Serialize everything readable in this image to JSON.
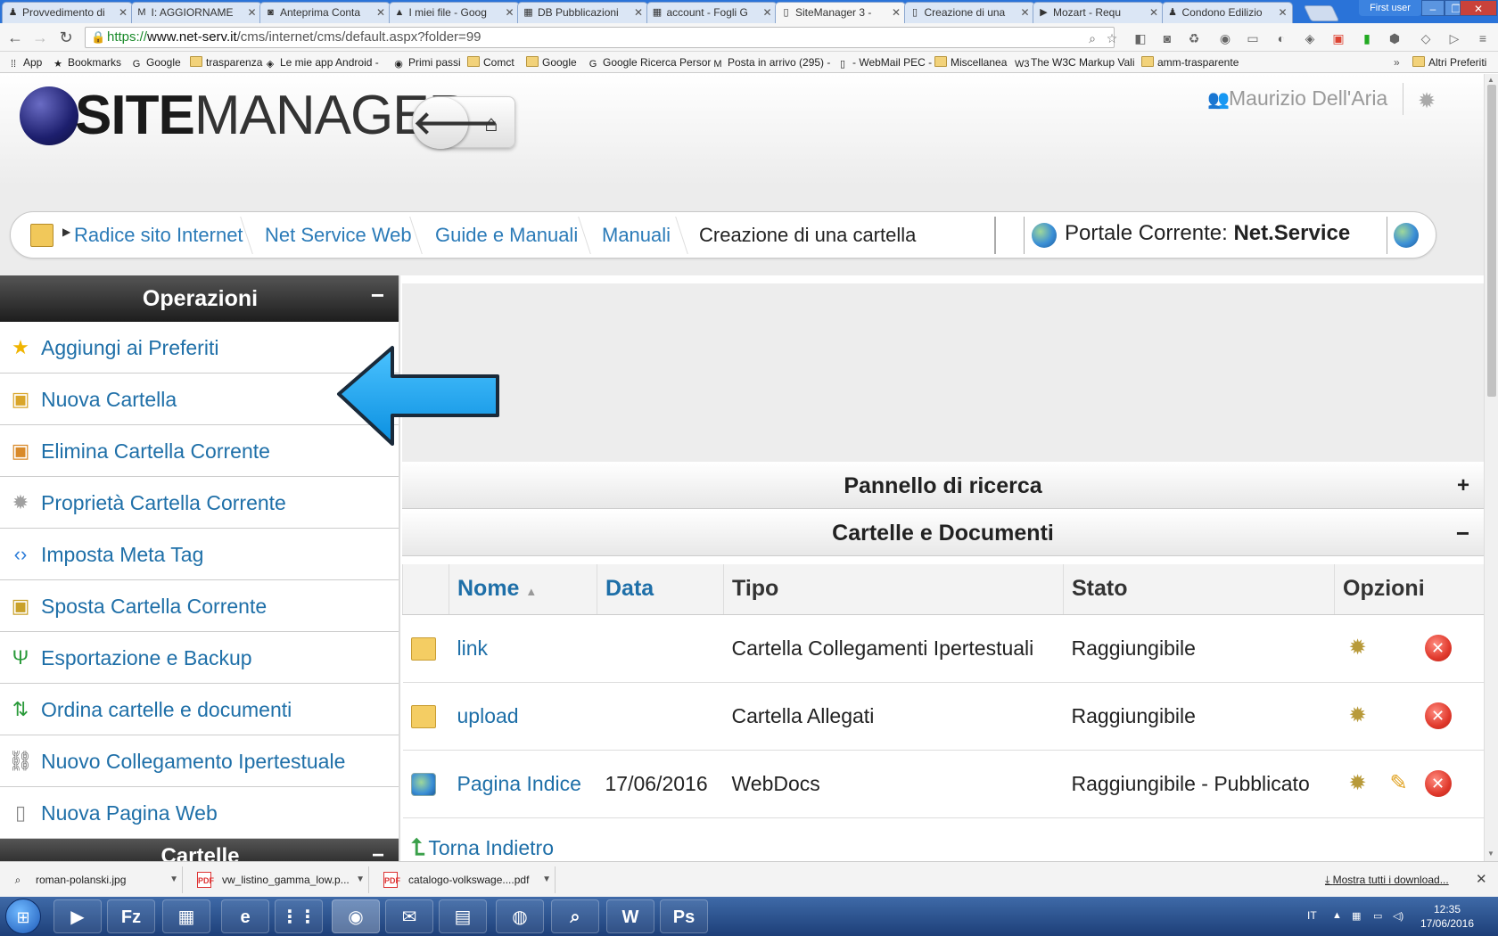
{
  "browser": {
    "tabs": [
      {
        "title": "Provvedimento di",
        "icon": "document-tab-icon"
      },
      {
        "title": "I: AGGIORNAME",
        "icon": "gmail-icon"
      },
      {
        "title": "Anteprima Conta",
        "icon": "contacts-icon"
      },
      {
        "title": "I miei file - Goog",
        "icon": "drive-icon"
      },
      {
        "title": "DB Pubblicazioni",
        "icon": "sheets-icon"
      },
      {
        "title": "account - Fogli G",
        "icon": "sheets-icon"
      },
      {
        "title": "SiteManager 3 -",
        "icon": "page-icon"
      },
      {
        "title": "Creazione di una",
        "icon": "page-icon"
      },
      {
        "title": "Mozart - Requ",
        "icon": "youtube-icon"
      },
      {
        "title": "Condono Edilizio",
        "icon": "document-tab-icon"
      }
    ],
    "active_tab_index": 6,
    "profile": "First user",
    "url": {
      "scheme": "https://",
      "host": "www.net-serv.it",
      "path": "/cms/internet/cms/default.aspx?folder=99"
    },
    "bookmarks": [
      {
        "label": "App",
        "icon": "apps-grid-icon"
      },
      {
        "label": "Bookmarks",
        "icon": "star-icon"
      },
      {
        "label": "Google",
        "icon": "google-icon"
      },
      {
        "label": "trasparenza",
        "icon": "folder-icon"
      },
      {
        "label": "Le mie app Android -",
        "icon": "android-icon"
      },
      {
        "label": "Primi passi",
        "icon": "firefox-icon"
      },
      {
        "label": "Comct",
        "icon": "folder-icon"
      },
      {
        "label": "Google",
        "icon": "folder-icon"
      },
      {
        "label": "Google Ricerca Persor",
        "icon": "google-icon"
      },
      {
        "label": "Posta in arrivo (295) -",
        "icon": "gmail-icon"
      },
      {
        "label": "- WebMail PEC -",
        "icon": "page-icon"
      },
      {
        "label": "Miscellanea",
        "icon": "folder-icon"
      },
      {
        "label": "The W3C Markup Vali",
        "icon": "w3c-icon"
      },
      {
        "label": "amm-trasparente",
        "icon": "folder-icon"
      }
    ],
    "other_bookmarks": "Altri Preferiti"
  },
  "site": {
    "logo": {
      "bold": "SITE",
      "light": "MANAGER"
    },
    "user_name": "Maurizio Dell'Aria",
    "breadcrumb": [
      "Radice sito Internet",
      "Net Service Web",
      "Guide e Manuali",
      "Manuali",
      "Creazione di una cartella"
    ],
    "portal_label": "Portale Corrente:",
    "portal_name": "Net.Service"
  },
  "sidebar": {
    "title": "Operazioni",
    "collapse": "−",
    "items": [
      {
        "label": "Aggiungi ai Preferiti",
        "icon": "star-icon"
      },
      {
        "label": "Nuova Cartella",
        "icon": "new-folder-icon"
      },
      {
        "label": "Elimina Cartella Corrente",
        "icon": "delete-folder-icon"
      },
      {
        "label": "Proprietà Cartella Corrente",
        "icon": "gear-icon"
      },
      {
        "label": "Imposta Meta Tag",
        "icon": "code-tag-icon"
      },
      {
        "label": "Sposta Cartella Corrente",
        "icon": "move-folder-icon"
      },
      {
        "label": "Esportazione e Backup",
        "icon": "export-icon"
      },
      {
        "label": "Ordina cartelle e documenti",
        "icon": "sort-arrows-icon"
      },
      {
        "label": "Nuovo Collegamento Ipertestuale",
        "icon": "chain-link-icon"
      },
      {
        "label": "Nuova Pagina Web",
        "icon": "new-page-icon"
      }
    ],
    "second_section_title": "Cartelle",
    "second_section_collapse": "−"
  },
  "main": {
    "search_panel": {
      "title": "Pannello di ricerca",
      "toggle": "+"
    },
    "docs_panel": {
      "title": "Cartelle e Documenti",
      "toggle": "−"
    },
    "table": {
      "headers": {
        "name": "Nome",
        "date": "Data",
        "type": "Tipo",
        "status": "Stato",
        "options": "Opzioni"
      },
      "rows": [
        {
          "icon": "folder-icon",
          "name": "link",
          "date": "",
          "type": "Cartella Collegamenti Ipertestuali",
          "status": "Raggiungibile",
          "options": [
            "gear-icon",
            "delete-icon"
          ]
        },
        {
          "icon": "folder-icon",
          "name": "upload",
          "date": "",
          "type": "Cartella Allegati",
          "status": "Raggiungibile",
          "options": [
            "gear-icon",
            "delete-icon"
          ]
        },
        {
          "icon": "webdoc-icon",
          "name": "Pagina Indice",
          "date": "17/06/2016",
          "type": "WebDocs",
          "status": "Raggiungibile - Pubblicato",
          "options": [
            "gear-icon",
            "pencil-icon",
            "delete-icon"
          ]
        }
      ]
    },
    "back_link": "Torna Indietro"
  },
  "downloads": {
    "items": [
      {
        "name": "roman-polanski.jpg",
        "icon": "image-file-icon"
      },
      {
        "name": "vw_listino_gamma_low.p...",
        "icon": "pdf-icon"
      },
      {
        "name": "catalogo-volkswage....pdf",
        "icon": "pdf-icon"
      }
    ],
    "show_all": "Mostra tutti i download..."
  },
  "taskbar": {
    "apps": [
      {
        "name": "media-player-icon",
        "glyph": "▶"
      },
      {
        "name": "filezilla-icon",
        "glyph": "Fz"
      },
      {
        "name": "file-explorer-icon",
        "glyph": "▦"
      },
      {
        "name": "internet-explorer-icon",
        "glyph": "e"
      },
      {
        "name": "apps-icon",
        "glyph": "⋮⋮"
      },
      {
        "name": "chrome-icon",
        "glyph": "◉"
      },
      {
        "name": "mail-icon",
        "glyph": "✉"
      },
      {
        "name": "notes-icon",
        "glyph": "▤"
      },
      {
        "name": "disc-icon",
        "glyph": "◍"
      },
      {
        "name": "magnifier-icon",
        "glyph": "⌕"
      },
      {
        "name": "word-icon",
        "glyph": "W"
      },
      {
        "name": "photoshop-icon",
        "glyph": "Ps"
      }
    ],
    "language": "IT",
    "time": "12:35",
    "date": "17/06/2016"
  },
  "colors": {
    "link": "#1e6fa8",
    "accent_arrow": "#1aa3f0",
    "header_dark": "#1d1d1d"
  }
}
